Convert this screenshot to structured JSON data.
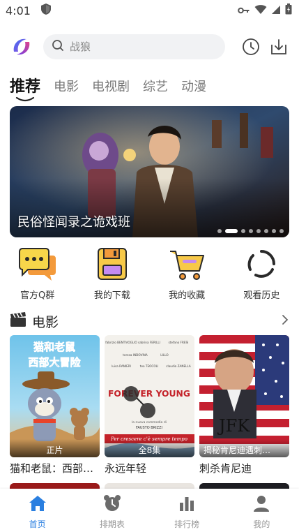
{
  "status_bar": {
    "time": "4:01"
  },
  "search": {
    "placeholder": "战狼"
  },
  "tabs": [
    {
      "label": "推荐",
      "active": true
    },
    {
      "label": "电影"
    },
    {
      "label": "电视剧"
    },
    {
      "label": "综艺"
    },
    {
      "label": "动漫"
    }
  ],
  "banner": {
    "title": "民俗怪闻录之诡戏班",
    "slide_count": 8,
    "active_index": 1
  },
  "quick_actions": [
    {
      "label": "官方Q群",
      "icon": "chat-icon"
    },
    {
      "label": "我的下载",
      "icon": "download-box-icon"
    },
    {
      "label": "我的收藏",
      "icon": "cart-icon"
    },
    {
      "label": "观看历史",
      "icon": "history-ring-icon"
    }
  ],
  "section": {
    "title": "电影",
    "icon": "clapperboard-icon"
  },
  "movies": [
    {
      "title": "猫和老鼠：西部大冒险",
      "badge": "正片",
      "poster_title": "猫和老鼠",
      "poster_subtitle": "西部大冒险"
    },
    {
      "title": "永远年轻",
      "badge": "全8集",
      "poster_title": "FOREVER YOUNG",
      "poster_credits": [
        "fabrizio BENTIVOGLIO",
        "sabrina FERILLI",
        "stefano FRESI",
        "teresa INDOVINA",
        "LILLO",
        "luisa RANIERI",
        "teo TEOCOLI",
        "claudia ZANELLA"
      ],
      "poster_note": "la nuova commedia di",
      "poster_director": "FAUSTO BRIZZI",
      "poster_tagline": "Per crescere c'è sempre tempo"
    },
    {
      "title": "刺杀肯尼迪",
      "badge": "揭秘肯尼迪遇刺…",
      "poster_title": "JFK"
    }
  ],
  "bottom_nav": [
    {
      "label": "首页",
      "active": true,
      "icon": "home-icon"
    },
    {
      "label": "排期表",
      "icon": "alarm-clock-icon"
    },
    {
      "label": "排行榜",
      "icon": "bar-chart-icon"
    },
    {
      "label": "我的",
      "icon": "user-icon"
    }
  ],
  "colors": {
    "accent": "#2a7fe0",
    "search_bg": "#f1f2f4",
    "quick_yellow": "#f7c948",
    "quick_orange": "#f39a3b"
  }
}
